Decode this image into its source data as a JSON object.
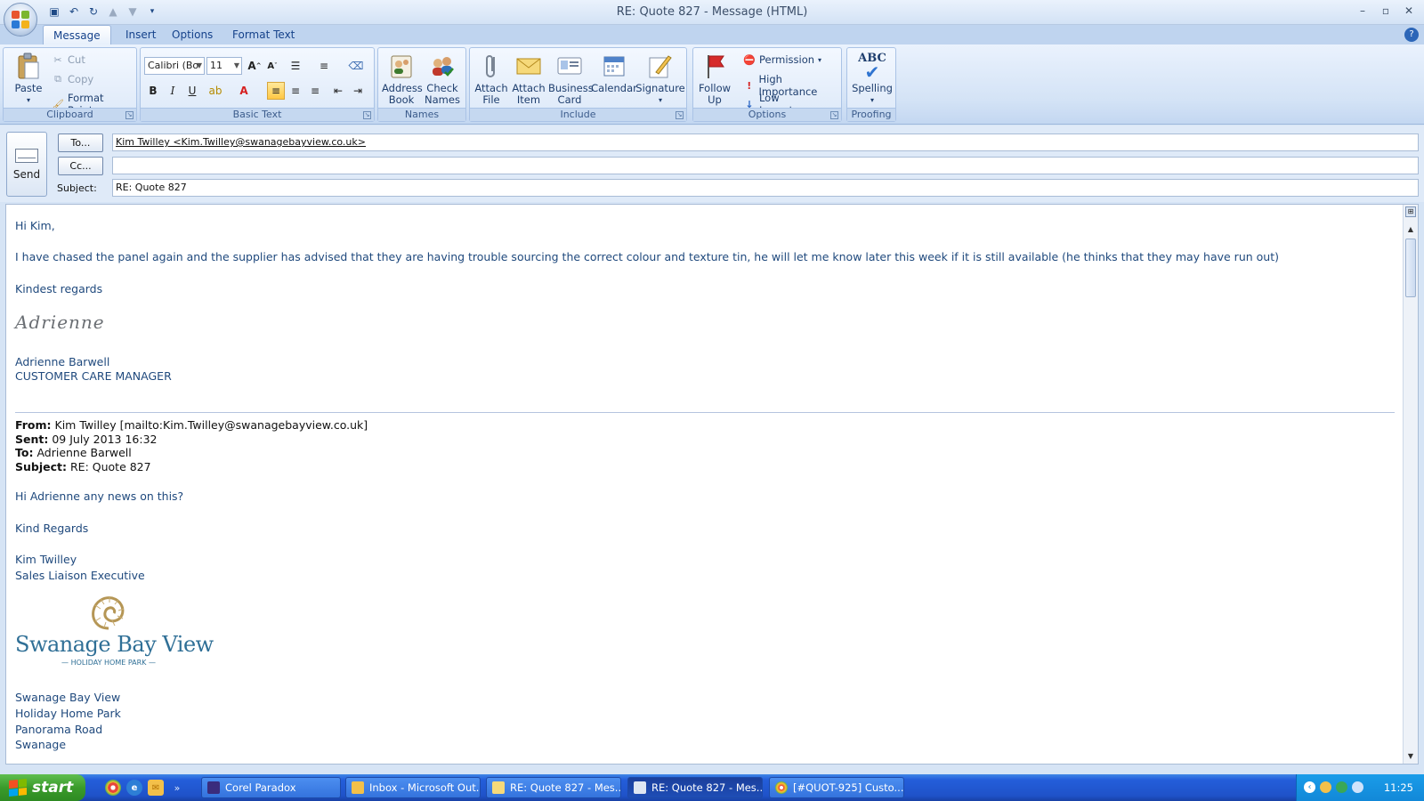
{
  "window": {
    "title": "RE: Quote 827 - Message (HTML)",
    "controls": [
      "–",
      "▫",
      "✕"
    ]
  },
  "ribbon": {
    "tabs": [
      "Message",
      "Insert",
      "Options",
      "Format Text"
    ],
    "clipboard": {
      "label": "Clipboard",
      "paste": "Paste",
      "cut": "Cut",
      "copy": "Copy",
      "format_painter": "Format Painter"
    },
    "basic_text": {
      "label": "Basic Text",
      "font": "Calibri (Bo",
      "size": "11",
      "bold": "B",
      "italic": "I",
      "underline": "U"
    },
    "names": {
      "label": "Names",
      "address_book": "Address Book",
      "check_names": "Check Names"
    },
    "include": {
      "label": "Include",
      "attach_file": "Attach File",
      "attach_item": "Attach Item",
      "business_card": "Business Card",
      "calendar": "Calendar",
      "signature": "Signature"
    },
    "options": {
      "label": "Options",
      "follow_up": "Follow Up",
      "permission": "Permission",
      "high_importance": "High Importance",
      "low_importance": "Low Importance"
    },
    "proofing": {
      "label": "Proofing",
      "spelling": "Spelling",
      "abc": "ABC"
    }
  },
  "header": {
    "send": "Send",
    "to_button": "To...",
    "cc_button": "Cc...",
    "subject_label": "Subject:",
    "to_value": "Kim Twilley <Kim.Twilley@swanagebayview.co.uk>",
    "cc_value": "",
    "subject_value": "RE: Quote 827"
  },
  "body": {
    "greeting": "Hi Kim,",
    "paragraph": "I have chased the panel again and the supplier has advised that they are having trouble sourcing the correct colour and texture tin, he will let me know later this week if it is still available (he thinks that they may have run out)",
    "closing": "Kindest regards",
    "signature_script": "Adrienne",
    "sender_name": "Adrienne Barwell",
    "sender_title": "CUSTOMER CARE MANAGER",
    "quoted": {
      "from_label": "From:",
      "from_value": "Kim Twilley [mailto:Kim.Twilley@swanagebayview.co.uk]",
      "sent_label": "Sent:",
      "sent_value": "09 July 2013 16:32",
      "to_label": "To:",
      "to_value": "Adrienne Barwell",
      "subject_label": "Subject:",
      "subject_value": "RE: Quote 827",
      "line1": "Hi Adrienne any news on this?",
      "line2": "Kind Regards",
      "name": "Kim Twilley",
      "role": "Sales Liaison Executive",
      "logo_name": "Swanage Bay View",
      "logo_tag": "— HOLIDAY HOME PARK —",
      "addr1": "Swanage Bay View",
      "addr2": "Holiday Home Park",
      "addr3": "Panorama Road",
      "addr4": "Swanage"
    }
  },
  "taskbar": {
    "start": "start",
    "tasks": [
      "Corel Paradox",
      "Inbox - Microsoft Out...",
      "RE: Quote 827 - Mes...",
      "RE: Quote 827 - Mes...",
      "[#QUOT-925] Custo..."
    ],
    "clock": "11:25"
  },
  "colors": {
    "body_text": "#1f497d",
    "ribbon_text": "#15428b",
    "taskbar_blue": "#245edb",
    "start_green": "#3a9b2b"
  }
}
